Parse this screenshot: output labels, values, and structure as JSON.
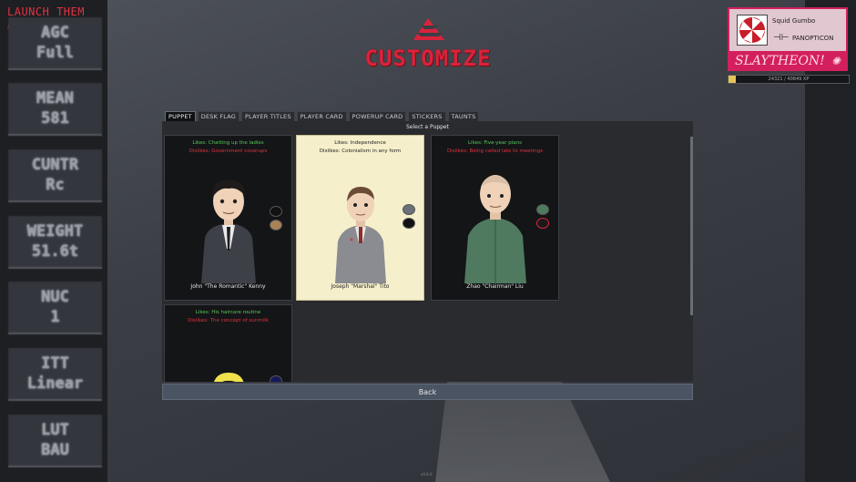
{
  "launch_title": "LAUNCH THEM ALL",
  "stats": [
    {
      "line1": "AGC",
      "line2": "Full"
    },
    {
      "line1": "MEAN",
      "line2": "581"
    },
    {
      "line1": "CUNTR",
      "line2": "Rc"
    },
    {
      "line1": "WEIGHT",
      "line2": "51.6t"
    },
    {
      "line1": "NUC",
      "line2": "1"
    },
    {
      "line1": "ITT",
      "line2": "Linear"
    },
    {
      "line1": "LUT",
      "line2": "BAU"
    }
  ],
  "page_title": "CUSTOMIZE",
  "player": {
    "name": "Squid Gumbo",
    "org": "PANOPTICON",
    "banner": "SLAYTHEON!",
    "xp_text": "24321 / 40849 XP",
    "xp_fraction": 0.06
  },
  "tabs": [
    "PUPPET",
    "DESK FLAG",
    "PLAYER TITLES",
    "PLAYER CARD",
    "POWERUP CARD",
    "STICKERS",
    "TAUNTS"
  ],
  "active_tab": "PUPPET",
  "panel_header": "Select a Puppet",
  "puppets": [
    {
      "likes": "Likes: Chatting up the ladies",
      "dislikes": "Dislikes: Government coverups",
      "name": "John \"The Romantic\" Kenny"
    },
    {
      "likes": "Likes: Independence",
      "dislikes": "Dislikes: Colonialism in any form",
      "name": "Joseph \"Marshal\" Tito"
    },
    {
      "likes": "Likes: Five-year plans",
      "dislikes": "Dislikes: Being called late to meetings",
      "name": "Zhao \"Chairman\" Liu"
    },
    {
      "likes": "Likes: His haircare routine",
      "dislikes": "Dislikes: The concept of sunmilk",
      "name": ""
    }
  ],
  "back_label": "Back",
  "version": "v0.9.0",
  "colors": {
    "accent_red": "#d9233a",
    "card_pink": "#d31f5d",
    "likes_green": "#56c65b",
    "dislikes_red": "#e0323e",
    "selected_card": "#f5efcb"
  }
}
